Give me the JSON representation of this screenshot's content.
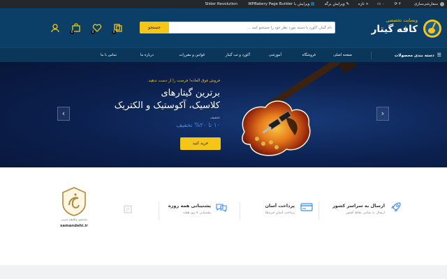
{
  "admin_bar": {
    "items": [
      "سفارشی‌سازی",
      "۴",
      "۰",
      "تازه",
      "ویرایش برگه",
      "ویرایش با WPBakery Page Builder",
      "Slider Revolution"
    ]
  },
  "header": {
    "tagline": "وبسایت تخصصی",
    "brand": "کافه گیتار",
    "search_placeholder": "نام گیتار، آکورد یا دسته مورد نظر خود را جستجو کنید ...",
    "search_button": "جستجو",
    "cart_count": "0",
    "wishlist_count": "0",
    "compare_count": "0"
  },
  "nav": {
    "categories_label": "دسته بندی محصولات",
    "items": [
      "صفحه اصلی",
      "فروشگاه",
      "آموزشی",
      "آکورد و تب گیتار",
      "قوانین و مقررات",
      "درباره ما",
      "تماس با ما"
    ]
  },
  "hero": {
    "promo": "فروش فوق العاده! فرصت را از دست ندهید.",
    "title_line1": "برترین گیتارهای",
    "title_line2": "کلاسیک، آکوستیک و الکتریک",
    "discount_label": "تخفیف",
    "discount_text": "۱۰ تا ۲۰% تخفیف",
    "cta": "خرید کنید"
  },
  "features": [
    {
      "title": "ارسال به سراسر کشور",
      "subtitle": "ارسال به تمامی نقاط کشور",
      "icon": "rocket-icon"
    },
    {
      "title": "پرداخت آسان",
      "subtitle": "پرداخت آسان خریدها",
      "icon": "credit-card-icon"
    },
    {
      "title": "پشتیبانی همه روزه",
      "subtitle": "پشتیبانی ۷ روز هفته",
      "icon": "chat-icon"
    }
  ],
  "badge": {
    "caption": "samandehi.ir",
    "small": "ساماندهی پایگاه‌های اینترنتی"
  },
  "colors": {
    "header_bg": "#0b3f68",
    "nav_bg": "#0a3659",
    "accent_yellow": "#f5c518",
    "hero_bg": "#0c2150",
    "discount_blue": "#3d8cf0",
    "admin_bg": "#23282d"
  }
}
